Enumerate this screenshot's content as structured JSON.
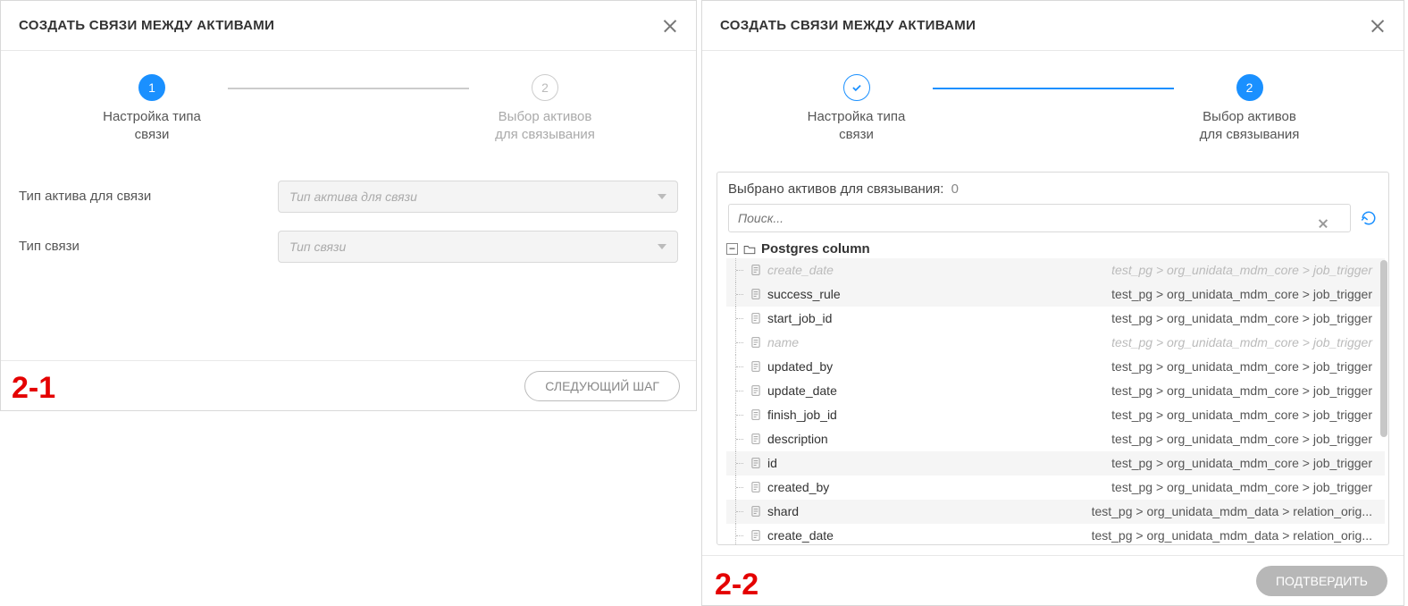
{
  "left": {
    "title": "СОЗДАТЬ СВЯЗИ МЕЖДУ АКТИВАМИ",
    "step1_num": "1",
    "step1_label_l1": "Настройка типа",
    "step1_label_l2": "связи",
    "step2_num": "2",
    "step2_label_l1": "Выбор активов",
    "step2_label_l2": "для связывания",
    "field1_label": "Тип актива для связи",
    "field1_placeholder": "Тип актива для связи",
    "field2_label": "Тип связи",
    "field2_placeholder": "Тип связи",
    "next_btn": "СЛЕДУЮЩИЙ ШАГ",
    "annotation": "2-1"
  },
  "right": {
    "title": "СОЗДАТЬ СВЯЗИ МЕЖДУ АКТИВАМИ",
    "step1_label_l1": "Настройка типа",
    "step1_label_l2": "связи",
    "step2_num": "2",
    "step2_label_l1": "Выбор активов",
    "step2_label_l2": "для связывания",
    "selected_label": "Выбрано активов для связывания:",
    "selected_count": "0",
    "search_placeholder": "Поиск...",
    "root_label": "Postgres column",
    "items": [
      {
        "name": "create_date",
        "path": "test_pg > org_unidata_mdm_core > job_trigger",
        "disabled": true,
        "stripe": true
      },
      {
        "name": "success_rule",
        "path": "test_pg > org_unidata_mdm_core > job_trigger",
        "disabled": false,
        "stripe": true
      },
      {
        "name": "start_job_id",
        "path": "test_pg > org_unidata_mdm_core > job_trigger",
        "disabled": false,
        "stripe": false
      },
      {
        "name": "name",
        "path": "test_pg > org_unidata_mdm_core > job_trigger",
        "disabled": true,
        "stripe": false
      },
      {
        "name": "updated_by",
        "path": "test_pg > org_unidata_mdm_core > job_trigger",
        "disabled": false,
        "stripe": false
      },
      {
        "name": "update_date",
        "path": "test_pg > org_unidata_mdm_core > job_trigger",
        "disabled": false,
        "stripe": false
      },
      {
        "name": "finish_job_id",
        "path": "test_pg > org_unidata_mdm_core > job_trigger",
        "disabled": false,
        "stripe": false
      },
      {
        "name": "description",
        "path": "test_pg > org_unidata_mdm_core > job_trigger",
        "disabled": false,
        "stripe": false
      },
      {
        "name": "id",
        "path": "test_pg > org_unidata_mdm_core > job_trigger",
        "disabled": false,
        "stripe": true
      },
      {
        "name": "created_by",
        "path": "test_pg > org_unidata_mdm_core > job_trigger",
        "disabled": false,
        "stripe": false
      },
      {
        "name": "shard",
        "path": "test_pg > org_unidata_mdm_data > relation_orig...",
        "disabled": false,
        "stripe": true
      },
      {
        "name": "create_date",
        "path": "test_pg > org_unidata_mdm_data > relation_orig...",
        "disabled": false,
        "stripe": false
      }
    ],
    "confirm_btn": "ПОДТВЕРДИТЬ",
    "annotation": "2-2"
  }
}
